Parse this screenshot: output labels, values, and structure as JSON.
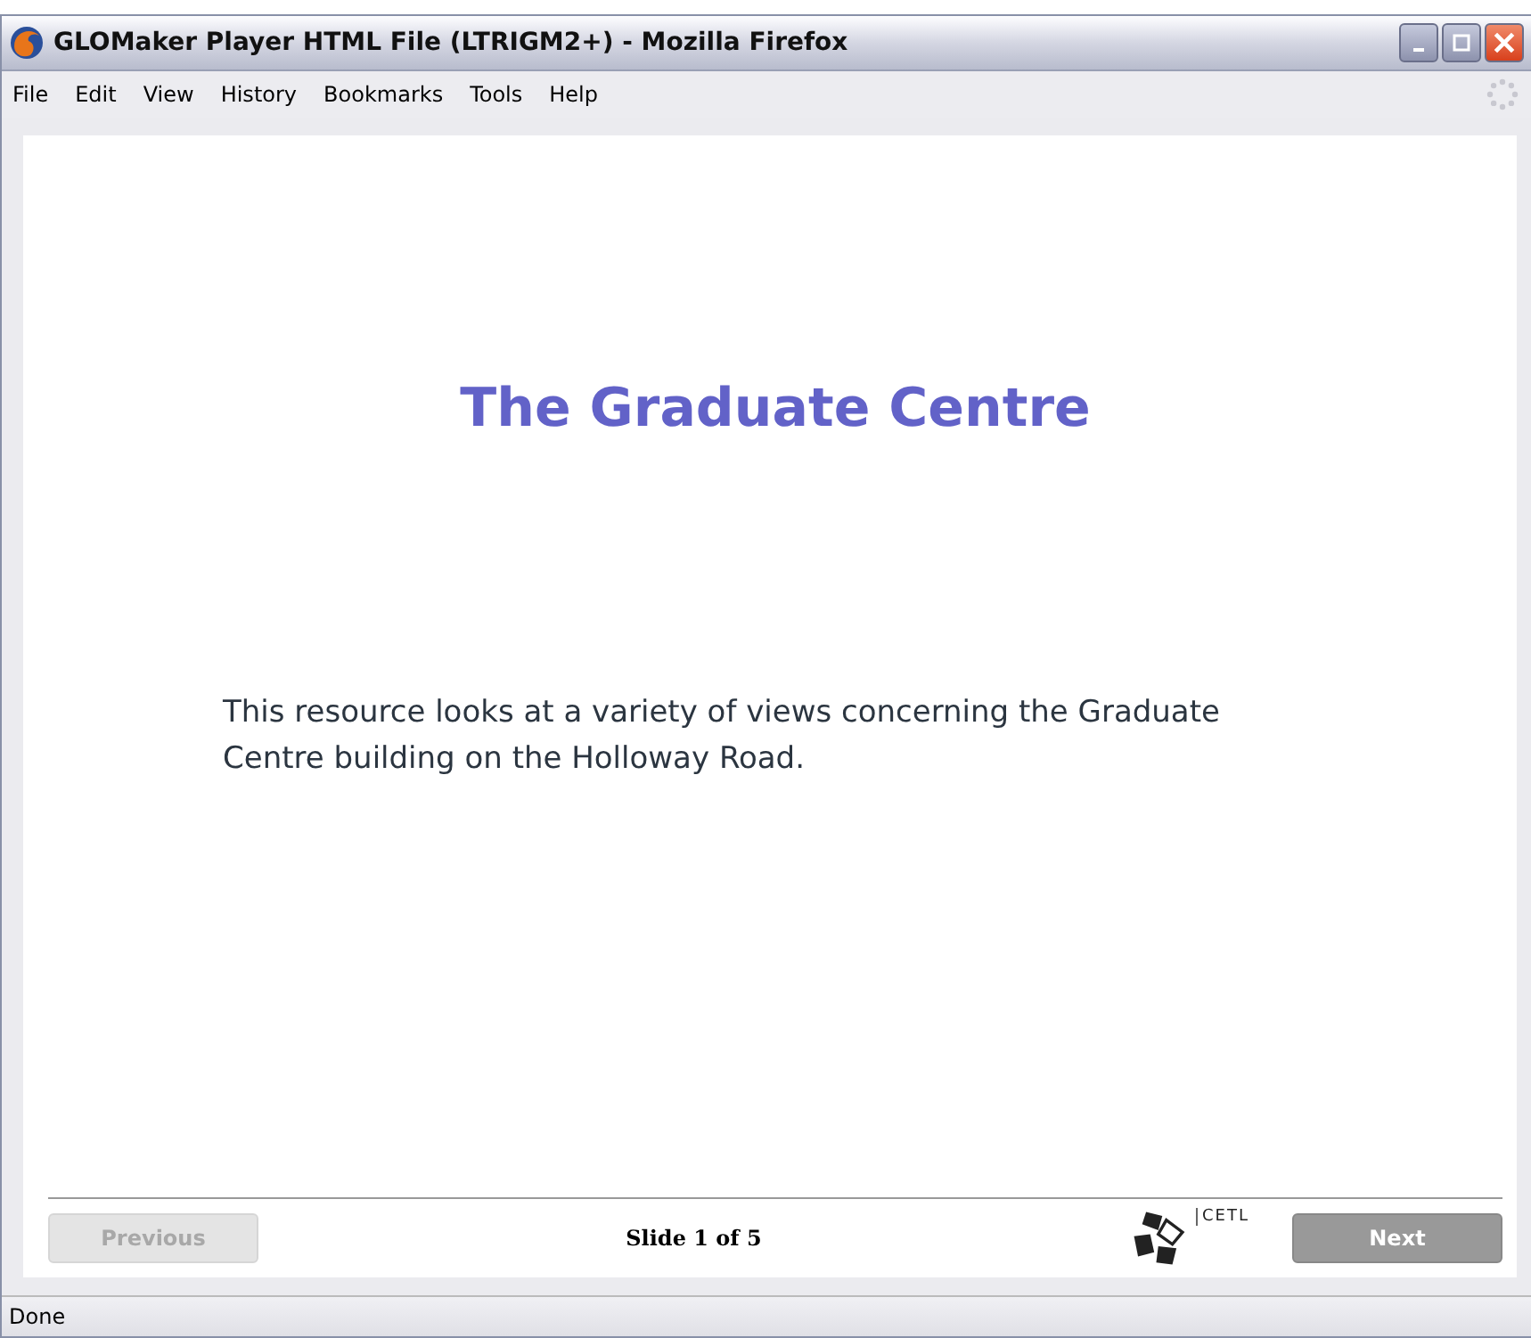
{
  "window": {
    "title": "GLOMaker Player HTML File (LTRIGM2+) - Mozilla Firefox"
  },
  "menu": [
    {
      "label": "File"
    },
    {
      "label": "Edit"
    },
    {
      "label": "View"
    },
    {
      "label": "History"
    },
    {
      "label": "Bookmarks"
    },
    {
      "label": "Tools"
    },
    {
      "label": "Help"
    }
  ],
  "slide": {
    "title": "The Graduate Centre",
    "text": "This resource looks at a variety of views concerning the Graduate Centre building on the Holloway Road."
  },
  "footer": {
    "previous": {
      "label": "Previous",
      "disabled": true
    },
    "counter": "Slide 1 of 5",
    "logo_text": "CETL",
    "next": {
      "label": "Next",
      "disabled": false
    }
  },
  "status_bar": "Done"
}
